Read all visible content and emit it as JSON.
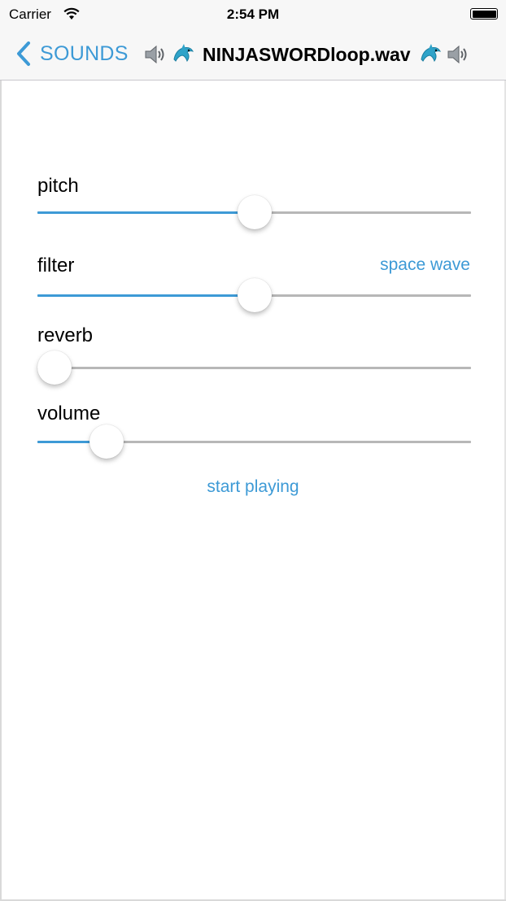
{
  "status_bar": {
    "carrier": "Carrier",
    "time": "2:54 PM"
  },
  "nav": {
    "back_label": "SOUNDS",
    "title": "NINJASWORDloop.wav",
    "title_icons": [
      "speaker-icon",
      "dolphin-icon",
      "dolphin-icon",
      "speaker-icon"
    ]
  },
  "controls": {
    "pitch": {
      "label": "pitch",
      "value": 0.5
    },
    "filter": {
      "label": "filter",
      "value_text": "space wave",
      "value": 0.5
    },
    "reverb": {
      "label": "reverb",
      "value": 0.0
    },
    "volume": {
      "label": "volume",
      "value": 0.13
    }
  },
  "actions": {
    "start_label": "start playing"
  },
  "colors": {
    "accent": "#3d9ad6",
    "track": "#b7b7b7",
    "bar_background": "#f7f7f7"
  }
}
